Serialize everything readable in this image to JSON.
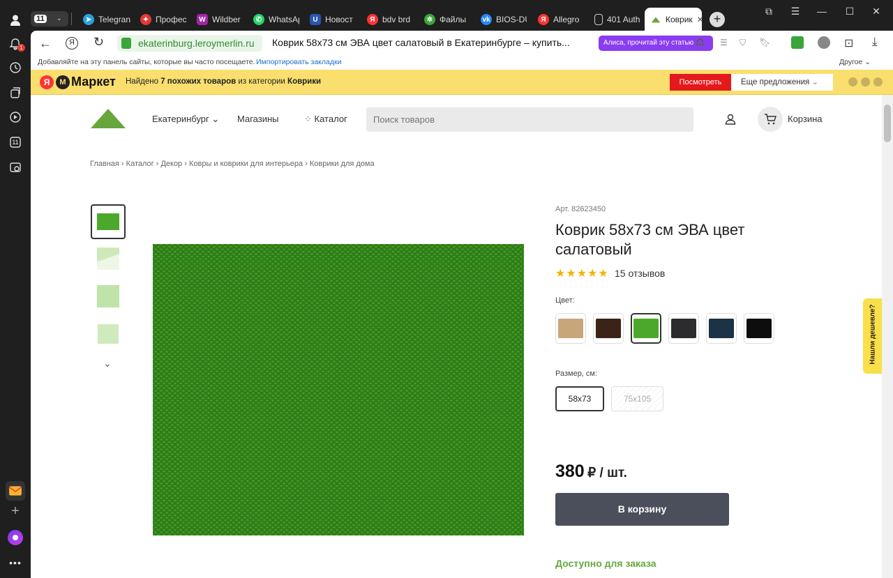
{
  "browser": {
    "tab_counter": "11",
    "tabs": [
      {
        "label": "Telegran",
        "icon": "telegram-icon",
        "color": "#2aa0db"
      },
      {
        "label": "Профес",
        "icon": "sparkle-icon",
        "color": "#e53935"
      },
      {
        "label": "Wildber",
        "icon": "wildberries-icon",
        "color": "#a424a8"
      },
      {
        "label": "WhatsAp",
        "icon": "whatsapp-icon",
        "color": "#25d366"
      },
      {
        "label": "Новост",
        "icon": "news-icon",
        "color": "#2956b0"
      },
      {
        "label": "bdv brd",
        "icon": "yandex-icon",
        "color": "#f33"
      },
      {
        "label": "Файлы",
        "icon": "files-icon",
        "color": "#3aa53a"
      },
      {
        "label": "BIOS-DU",
        "icon": "vk-icon",
        "color": "#2787f5"
      },
      {
        "label": "Allegro",
        "icon": "yandex-icon",
        "color": "#f33"
      },
      {
        "label": "401 Auth",
        "icon": "page-icon",
        "color": "#1f1f1f"
      },
      {
        "label": "Коврик",
        "icon": "leroy-icon",
        "color": "#ffffff"
      }
    ],
    "domain": "ekaterinburg.leroymerlin.ru",
    "page_title": "Коврик 58х73 см ЭВА цвет салатовый в Екатеринбурге – купить...",
    "alisa_label": "Алиса, прочитай эту статью",
    "bookmarks_hint": "Добавляйте на эту панель сайты, которые вы часто посещаете.",
    "bookmarks_import": "Импортировать закладки",
    "bookmarks_other": "Другое",
    "notif_badge": "1",
    "sidebar_badge": "11"
  },
  "market": {
    "brand": "Маркет",
    "found_prefix": "Найдено",
    "found_count": "7 похожих товаров",
    "found_mid": "из категории",
    "found_category": "Коврики",
    "view_btn": "Посмотреть",
    "more_btn": "Еще предложения"
  },
  "site": {
    "logo_text": "LEROY MERLIN",
    "city": "Екатеринбург",
    "stores": "Магазины",
    "catalog": "Каталог",
    "search_placeholder": "Поиск товаров",
    "cart": "Корзина"
  },
  "breadcrumb": [
    "Главная",
    "Каталог",
    "Декор",
    "Ковры и коврики для интерьера",
    "Коврики для дома"
  ],
  "product": {
    "article": "Арт. 82623450",
    "title_line1": "Коврик 58х73 см ЭВА цвет",
    "title_line2": "салатовый",
    "rating": 5,
    "stars": "★★★★★",
    "reviews": "15 отзывов",
    "color_label": "Цвет:",
    "colors": [
      "#c9a57a",
      "#3b2318",
      "#4ca82a",
      "#2c2c2e",
      "#1b3247",
      "#0d0d0d"
    ],
    "size_label": "Размер, см:",
    "sizes": [
      "58x73",
      "75x105"
    ],
    "price": "380",
    "price_unit": "₽ / шт.",
    "add_to_cart": "В корзину",
    "availability": "Доступно для заказа",
    "cheaper_tab": "Нашли дешевле?"
  }
}
